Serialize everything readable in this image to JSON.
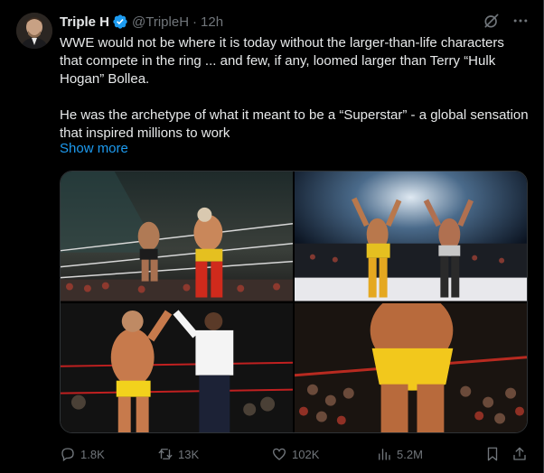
{
  "author": {
    "name": "Triple H",
    "handle": "@TripleH",
    "separator": "·",
    "time": "12h"
  },
  "tweet": {
    "paragraph1": "WWE would not be where it is today without the larger-than-life characters that compete in the ring ... and few, if any, loomed larger than Terry “Hulk Hogan” Bollea.",
    "paragraph2": "He was the archetype of what it meant to be a “Superstar” - a global sensation that inspired millions to work",
    "show_more": "Show more"
  },
  "icons": {
    "verified": "verified-badge-icon",
    "grok": "grok-icon",
    "more": "more-icon",
    "reply": "reply-icon",
    "retweet": "retweet-icon",
    "like": "heart-icon",
    "views": "views-chart-icon",
    "bookmark": "bookmark-icon",
    "share": "share-icon"
  },
  "stats": {
    "replies": "1.8K",
    "retweets": "13K",
    "likes": "102K",
    "views": "5.2M"
  },
  "colors": {
    "background": "#000000",
    "text": "#e7e9ea",
    "muted": "#71767b",
    "link": "#1d9bf0",
    "verified": "#1d9bf0"
  }
}
